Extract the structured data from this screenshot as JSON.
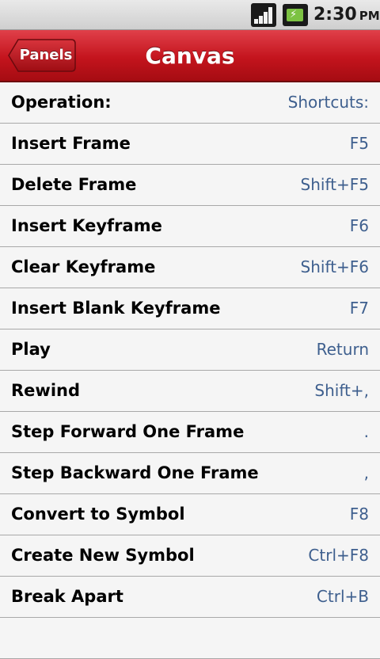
{
  "status_bar": {
    "time": "2:30",
    "ampm": "PM",
    "icons": [
      "signal-icon",
      "battery-charging-icon"
    ]
  },
  "header": {
    "back_label": "Panels",
    "title": "Canvas",
    "accent_color": "#c4141d"
  },
  "list": {
    "header": {
      "operation": "Operation:",
      "shortcut": "Shortcuts:"
    },
    "items": [
      {
        "operation": "Insert Frame",
        "shortcut": "F5"
      },
      {
        "operation": "Delete Frame",
        "shortcut": "Shift+F5"
      },
      {
        "operation": "Insert Keyframe",
        "shortcut": "F6"
      },
      {
        "operation": "Clear Keyframe",
        "shortcut": "Shift+F6"
      },
      {
        "operation": "Insert Blank Keyframe",
        "shortcut": "F7"
      },
      {
        "operation": "Play",
        "shortcut": "Return"
      },
      {
        "operation": "Rewind",
        "shortcut": "Shift+,"
      },
      {
        "operation": "Step Forward One Frame",
        "shortcut": "."
      },
      {
        "operation": "Step Backward One Frame",
        "shortcut": ","
      },
      {
        "operation": "Convert to Symbol",
        "shortcut": "F8"
      },
      {
        "operation": "Create New Symbol",
        "shortcut": "Ctrl+F8"
      },
      {
        "operation": "Break Apart",
        "shortcut": "Ctrl+B"
      }
    ],
    "shortcut_color": "#3e5f8e"
  }
}
